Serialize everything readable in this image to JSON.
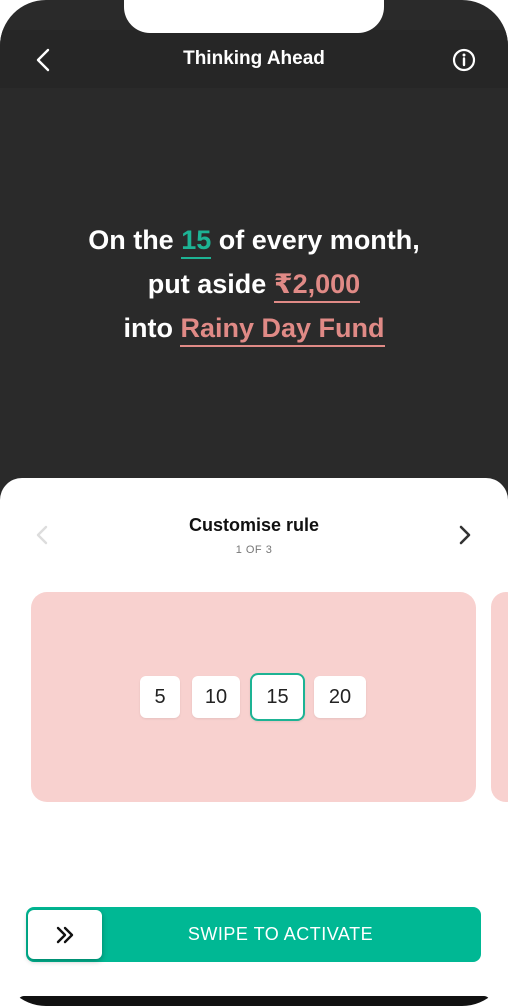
{
  "header": {
    "title": "Thinking Ahead",
    "back_icon": "chevron-left-icon",
    "info_icon": "info-circle-icon"
  },
  "headline": {
    "line1_prefix": "On the ",
    "day": "15",
    "line1_suffix": " of every month,",
    "line2_prefix": "put aside ",
    "amount": "₹2,000",
    "line3_prefix": "into ",
    "fund": "Rainy Day Fund"
  },
  "sheet": {
    "title": "Customise rule",
    "step": "1 OF 3",
    "prev_icon": "chevron-left-icon",
    "next_icon": "chevron-right-icon"
  },
  "day_options": [
    {
      "label": "5",
      "selected": false
    },
    {
      "label": "10",
      "selected": false
    },
    {
      "label": "15",
      "selected": true
    },
    {
      "label": "20",
      "selected": false
    }
  ],
  "swipe": {
    "label": "SWIPE TO ACTIVATE",
    "icon": "double-chevron-right-icon"
  },
  "colors": {
    "dark_bg": "#2a2a2a",
    "accent_green": "#1db394",
    "accent_pink": "#e08a86",
    "card_bg": "#f8d1cf",
    "swipe_bg": "#00b894"
  }
}
